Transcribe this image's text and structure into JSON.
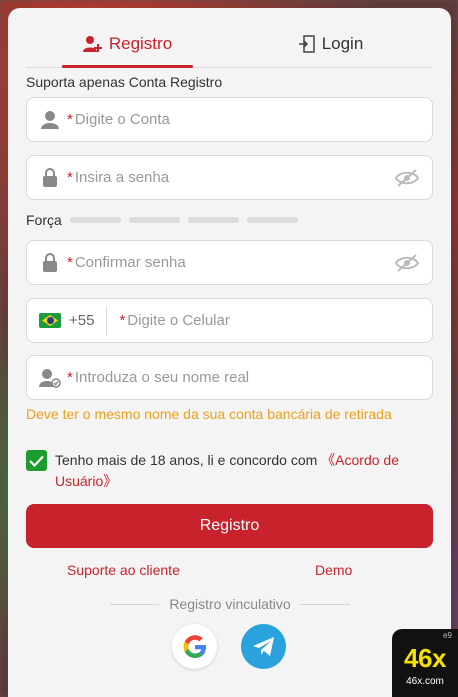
{
  "tabs": {
    "register": "Registro",
    "login": "Login"
  },
  "hint": "Suporta apenas Conta Registro",
  "fields": {
    "account": "Digite o Conta",
    "password": "Insira a senha",
    "confirm": "Confirmar senha",
    "phone_code": "+55",
    "phone": "Digite o Celular",
    "realname": "Introduza o seu nome real"
  },
  "required_mark": "*",
  "strength_label": "Força",
  "warning": "Deve ter o mesmo nome da sua conta bancária de retirada",
  "agree": {
    "text": "Tenho mais de 18 anos, li e concordo com ",
    "link": "《Acordo de Usuário》",
    "checked": true
  },
  "submit": "Registro",
  "links": {
    "support": "Suporte ao cliente",
    "demo": "Demo"
  },
  "divider": "Registro vinculativo",
  "badge": {
    "brand": "46x",
    "domain": "46x.com",
    "sup": "e9"
  },
  "colors": {
    "accent": "#c8232c",
    "warning": "#e8a21a",
    "check": "#1c9b2f",
    "telegram": "#2aa3dd"
  }
}
